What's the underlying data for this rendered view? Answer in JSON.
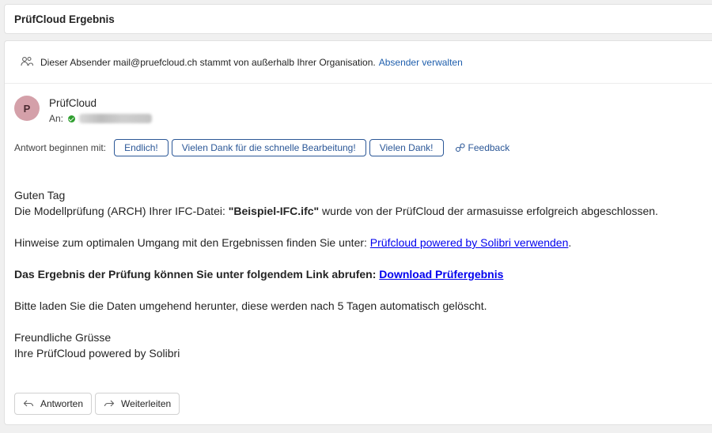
{
  "subject": "PrüfCloud Ergebnis",
  "banner": {
    "text": "Dieser Absender mail@pruefcloud.ch stammt von außerhalb Ihrer Organisation.",
    "link": "Absender verwalten"
  },
  "sender": {
    "initial": "P",
    "name": "PrüfCloud",
    "to_label": "An:"
  },
  "quick_replies": {
    "label": "Antwort beginnen mit:",
    "options": [
      "Endlich!",
      "Vielen Dank für die schnelle Bearbeitung!",
      "Vielen Dank!"
    ],
    "feedback": "Feedback"
  },
  "body": {
    "greeting": "Guten Tag",
    "line1_pre": "Die Modellprüfung (ARCH) Ihrer IFC-Datei: ",
    "line1_file": "\"Beispiel-IFC.ifc\"",
    "line1_post": " wurde von der PrüfCloud der armasuisse erfolgreich abgeschlossen.",
    "hint_pre": "Hinweise zum optimalen Umgang mit den Ergebnissen finden Sie unter: ",
    "hint_link": "Prüfcloud powered by Solibri verwenden",
    "hint_post": ".",
    "result_text": "Das Ergebnis der Prüfung können Sie unter folgendem Link abrufen: ",
    "result_link": "Download Prüfergebnis",
    "download_note": "Bitte laden Sie die Daten umgehend herunter, diese werden nach 5 Tagen automatisch gelöscht.",
    "closing": "Freundliche Grüsse",
    "signature": "Ihre PrüfCloud powered by Solibri"
  },
  "actions": {
    "reply": "Antworten",
    "forward": "Weiterleiten"
  },
  "colors": {
    "accent": "#2b5797",
    "link": "#0000ee",
    "avatar": "#d4a0a9",
    "verified": "#2e9e2e"
  }
}
